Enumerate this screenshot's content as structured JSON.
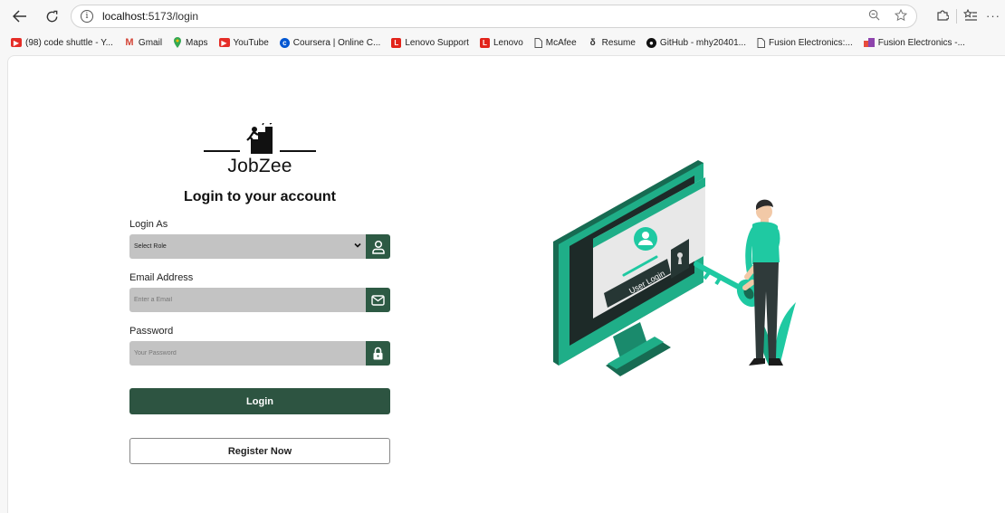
{
  "browser": {
    "url_host": "localhost",
    "url_path": ":5173/login"
  },
  "bookmarks": [
    {
      "label": "(98) code shuttle - Y...",
      "icon": "youtube-icon",
      "color": "#e52d27"
    },
    {
      "label": "Gmail",
      "icon": "gmail-icon",
      "color": "#d44638"
    },
    {
      "label": "Maps",
      "icon": "maps-icon",
      "color": "#34a853"
    },
    {
      "label": "YouTube",
      "icon": "youtube-icon",
      "color": "#e52d27"
    },
    {
      "label": "Coursera | Online C...",
      "icon": "coursera-icon",
      "color": "#0056d2"
    },
    {
      "label": "Lenovo Support",
      "icon": "lenovo-icon",
      "color": "#e2231a"
    },
    {
      "label": "Lenovo",
      "icon": "lenovo-icon",
      "color": "#e2231a"
    },
    {
      "label": "McAfee",
      "icon": "page-icon",
      "color": "#555555"
    },
    {
      "label": "Resume",
      "icon": "resume-icon",
      "color": "#333333"
    },
    {
      "label": "GitHub - mhy20401...",
      "icon": "github-icon",
      "color": "#111111"
    },
    {
      "label": "Fusion Electronics:...",
      "icon": "page-icon",
      "color": "#555555"
    },
    {
      "label": "Fusion Electronics -...",
      "icon": "fusion-icon",
      "color": "#8e44ad"
    }
  ],
  "login": {
    "brand": "JobZee",
    "title": "Login to your account",
    "role_label": "Login As",
    "role_value": "Select Role",
    "email_label": "Email Address",
    "email_placeholder": "Enter a Email",
    "password_label": "Password",
    "password_placeholder": "Your Password",
    "login_button": "Login",
    "register_button": "Register Now"
  },
  "illustration": {
    "screen_text": "User Login"
  },
  "colors": {
    "primary": "#2d5441",
    "accent": "#1fc9a2",
    "field_bg": "#c3c3c3"
  }
}
